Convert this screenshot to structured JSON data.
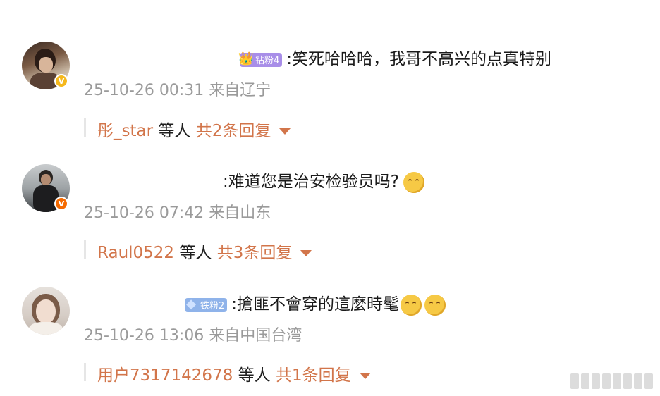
{
  "comments": [
    {
      "badge": {
        "label": "钻粉4",
        "color": "#a88ee8",
        "icon": "crown-icon"
      },
      "text": ":笑死哈哈哈，我哥不高兴的点真特别",
      "meta": "25-10-26 00:31 来自辽宁",
      "verified_color": "#f5b81c",
      "reply_user": "彤_star",
      "reply_mid": " 等人 ",
      "reply_count": "共2条回复"
    },
    {
      "text": ":难道您是治安检验员吗?",
      "emoji": "laugh-cry-emoji",
      "meta": "25-10-26 07:42 来自山东",
      "verified_color": "#f56a00",
      "reply_user": "Raul0522",
      "reply_mid": " 等人 ",
      "reply_count": "共3条回复"
    },
    {
      "badge": {
        "label": "铁粉2",
        "color": "#8fb3ea",
        "icon": "diamond-icon"
      },
      "text": ":搶匪不會穿的這麼時髦",
      "emoji": "thinking-emoji",
      "meta": "25-10-26 13:06 来自中国台湾",
      "reply_user": "用户7317142678",
      "reply_mid": " 等人 ",
      "reply_count": "共1条回复"
    }
  ]
}
